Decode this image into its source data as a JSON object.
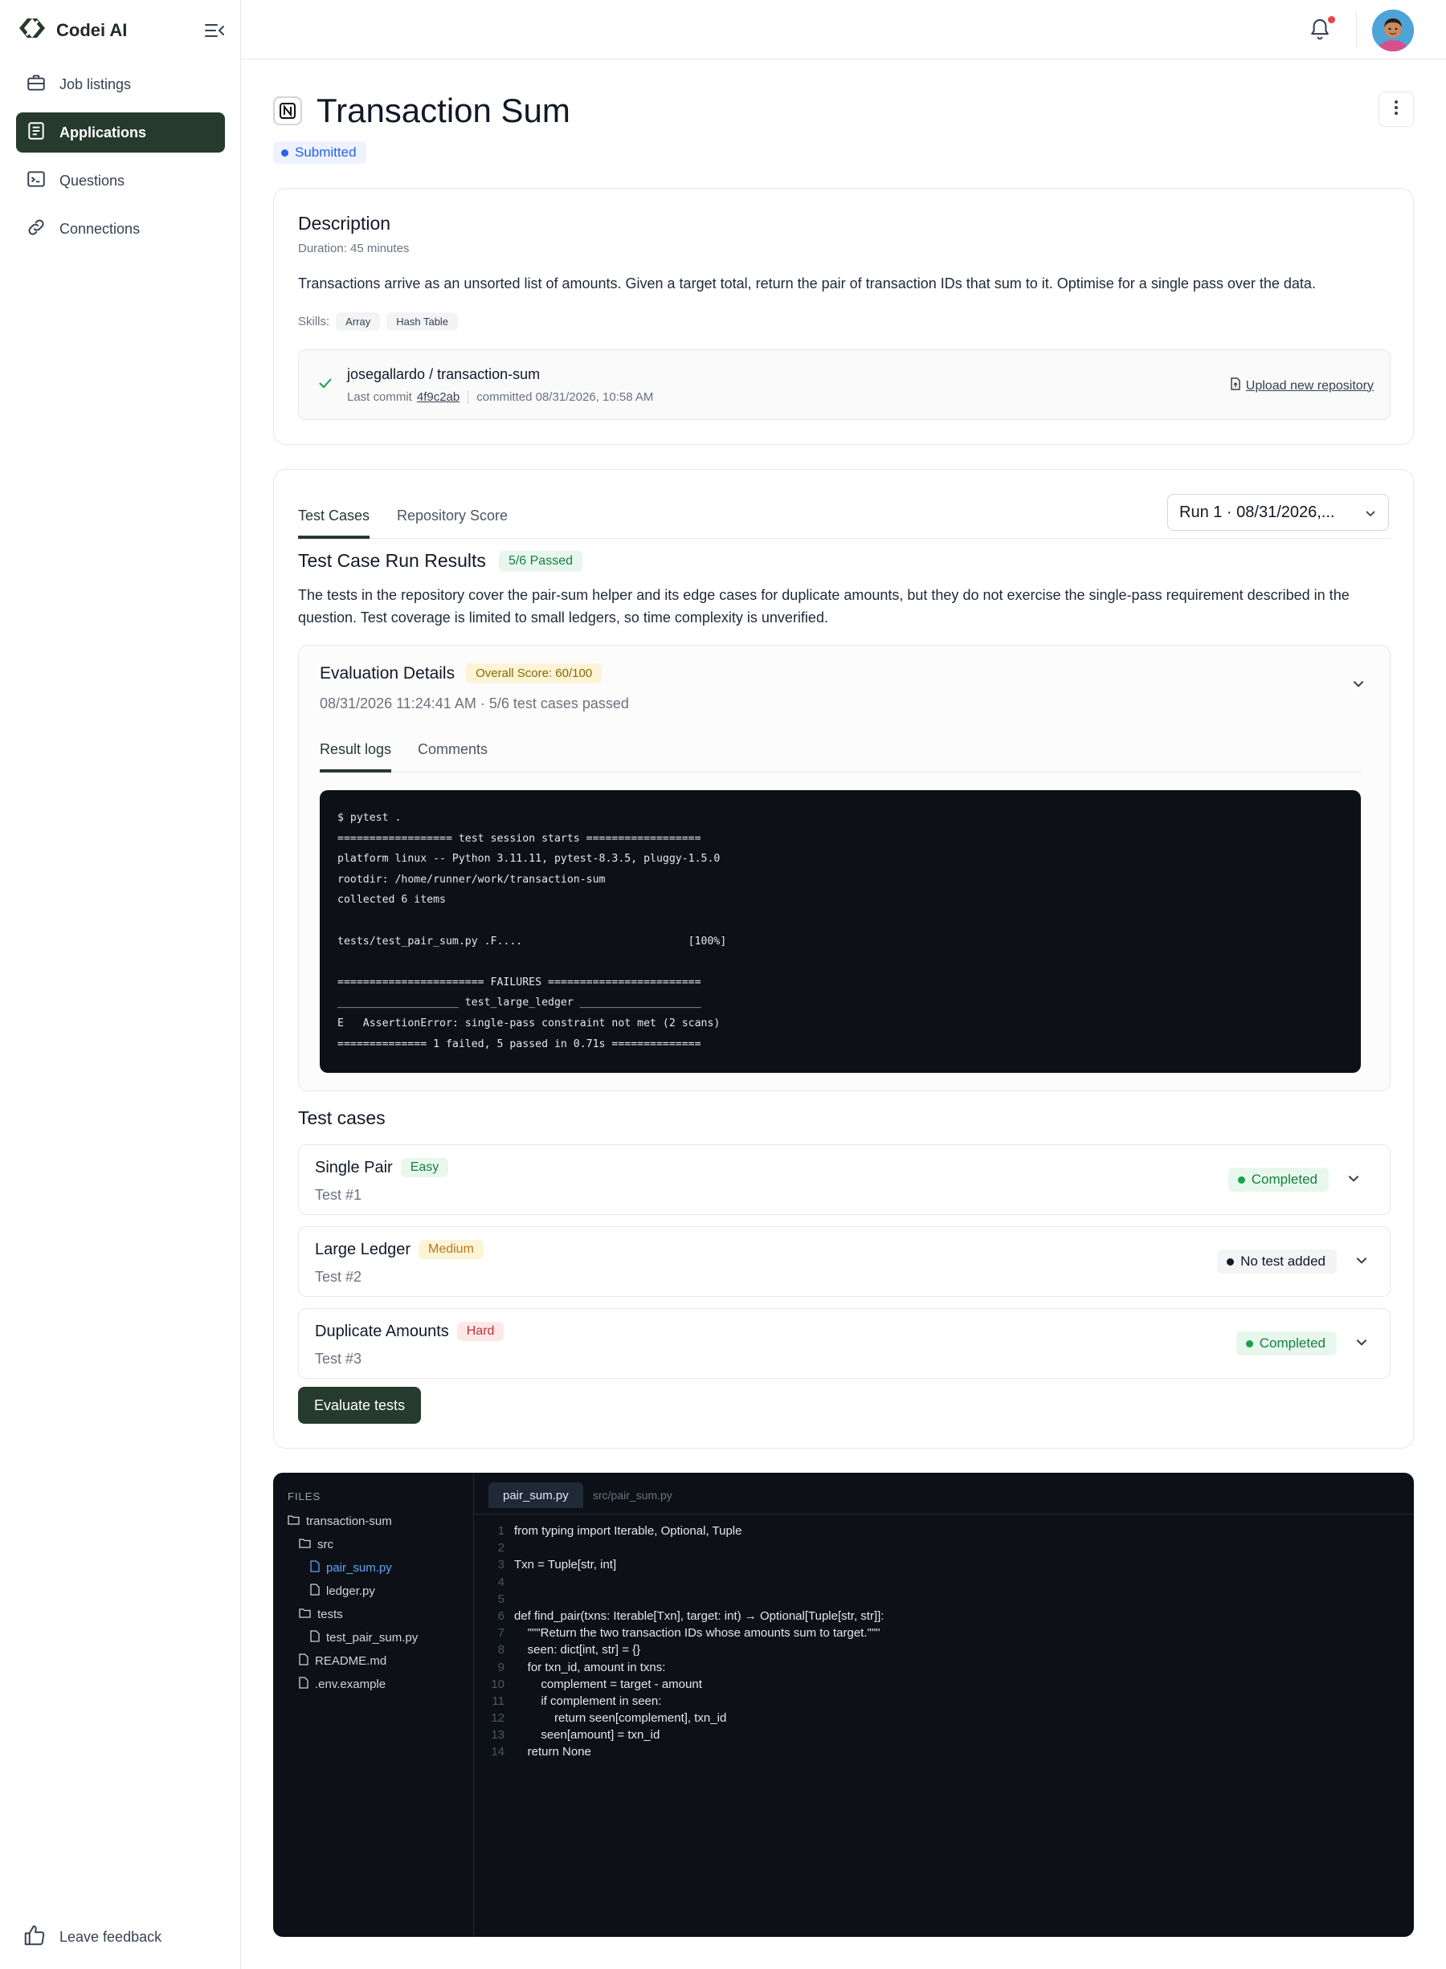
{
  "brand": {
    "name": "Codei AI"
  },
  "sidebar": {
    "items": [
      {
        "label": "Job listings",
        "icon": "briefcase-icon",
        "active": false
      },
      {
        "label": "Applications",
        "icon": "document-icon",
        "active": true
      },
      {
        "label": "Questions",
        "icon": "terminal-icon",
        "active": false
      },
      {
        "label": "Connections",
        "icon": "link-icon",
        "active": false
      }
    ],
    "feedback_label": "Leave feedback"
  },
  "page": {
    "title": "Transaction Sum",
    "status": "Submitted"
  },
  "description": {
    "heading": "Description",
    "duration": "Duration: 45 minutes",
    "text": "Transactions arrive as an unsorted list of amounts. Given a target total, return the pair of transaction IDs that sum to it. Optimise for a single pass over the data.",
    "skills_label": "Skills:",
    "skills": [
      "Array",
      "Hash Table"
    ],
    "repo": {
      "name": "josegallardo / transaction-sum",
      "last_commit_label": "Last commit",
      "commit_hash": "4f9c2ab",
      "committed": "committed 08/31/2026, 10:58 AM",
      "upload_label": "Upload new repository"
    }
  },
  "tests": {
    "tabs": [
      "Test Cases",
      "Repository Score"
    ],
    "run_select": "Run 1 · 08/31/2026,...",
    "run_title": "Test Case Run Results",
    "passed": "5/6 Passed",
    "summary": "The tests in the repository cover the pair-sum helper and its edge cases for duplicate amounts, but they do not exercise the single-pass requirement described in the question. Test coverage is limited to small ledgers, so time complexity is unverified.",
    "evaluation": {
      "title": "Evaluation Details",
      "score": "Overall Score: 60/100",
      "meta": "08/31/2026 11:24:41 AM · 5/6 test cases passed",
      "subtabs": [
        "Result logs",
        "Comments"
      ],
      "log": "$ pytest .\n================== test session starts ==================\nplatform linux -- Python 3.11.11, pytest-8.3.5, pluggy-1.5.0\nrootdir: /home/runner/work/transaction-sum\ncollected 6 items\n\ntests/test_pair_sum.py .F....                          [100%]\n\n======================= FAILURES ========================\n___________________ test_large_ledger ___________________\nE   AssertionError: single-pass constraint not met (2 scans)\n============== 1 failed, 5 passed in 0.71s =============="
    },
    "cases_heading": "Test cases",
    "cases": [
      {
        "name": "Single Pair",
        "difficulty": "Easy",
        "number": "Test #1",
        "status": "Completed"
      },
      {
        "name": "Large Ledger",
        "difficulty": "Medium",
        "number": "Test #2",
        "status": "No test added"
      },
      {
        "name": "Duplicate Amounts",
        "difficulty": "Hard",
        "number": "Test #3",
        "status": "Completed"
      }
    ],
    "evaluate_label": "Evaluate tests"
  },
  "code_viewer": {
    "files_label": "FILES",
    "tree": [
      {
        "name": "transaction-sum",
        "type": "folder",
        "depth": 0
      },
      {
        "name": "src",
        "type": "folder",
        "depth": 1
      },
      {
        "name": "pair_sum.py",
        "type": "file",
        "depth": 2,
        "selected": true
      },
      {
        "name": "ledger.py",
        "type": "file",
        "depth": 2
      },
      {
        "name": "tests",
        "type": "folder",
        "depth": 1
      },
      {
        "name": "test_pair_sum.py",
        "type": "file",
        "depth": 2
      },
      {
        "name": "README.md",
        "type": "file",
        "depth": 1
      },
      {
        "name": ".env.example",
        "type": "file",
        "depth": 1
      }
    ],
    "active_tab": "pair_sum.py",
    "path": "src/pair_sum.py",
    "lines": [
      "from typing import Iterable, Optional, Tuple",
      "",
      "Txn = Tuple[str, int]",
      "",
      "",
      "def find_pair(txns: Iterable[Txn], target: int) → Optional[Tuple[str, str]]:",
      "    \"\"\"Return the two transaction IDs whose amounts sum to target.\"\"\"",
      "    seen: dict[int, str] = {}",
      "    for txn_id, amount in txns:",
      "        complement = target - amount",
      "        if complement in seen:",
      "            return seen[complement], txn_id",
      "        seen[amount] = txn_id",
      "    return None"
    ]
  },
  "colors": {
    "accent": "#263a2e",
    "status_blue": "#2563eb",
    "success": "#15803d",
    "warning": "#b7791f",
    "danger": "#c53030",
    "terminal_bg": "#0d1117"
  }
}
